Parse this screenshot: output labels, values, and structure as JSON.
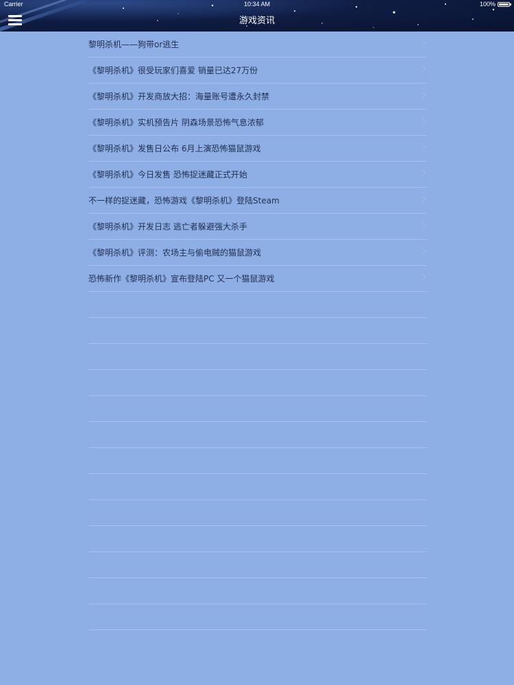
{
  "status_bar": {
    "carrier": "Carrier",
    "time": "10:34 AM",
    "battery": "100%"
  },
  "nav": {
    "title": "游戏资讯",
    "menu_icon": "hamburger-menu-icon"
  },
  "list": {
    "items": [
      "黎明杀机——狗带or逃生",
      "《黎明杀机》很受玩家们喜爱 销量已达27万份",
      "《黎明杀机》开发商放大招：海量账号遭永久封禁",
      "《黎明杀机》实机预告片 阴森场景恐怖气息浓郁",
      "《黎明杀机》发售日公布 6月上演恐怖猫鼠游戏",
      "《黎明杀机》今日发售 恐怖捉迷藏正式开始",
      "不一样的捉迷藏，恐怖游戏《黎明杀机》登陆Steam",
      "《黎明杀机》开发日志 逃亡者躲避强大杀手",
      "《黎明杀机》评测：农场主与偷电贼的猫鼠游戏",
      "恐怖新作《黎明杀机》宣布登陆PC 又一个猫鼠游戏"
    ],
    "empty_rows": 13
  },
  "colors": {
    "background": "#8eaee6",
    "separator": "#a9c2ee",
    "text": "#22304f",
    "header": "#0f1d44"
  }
}
